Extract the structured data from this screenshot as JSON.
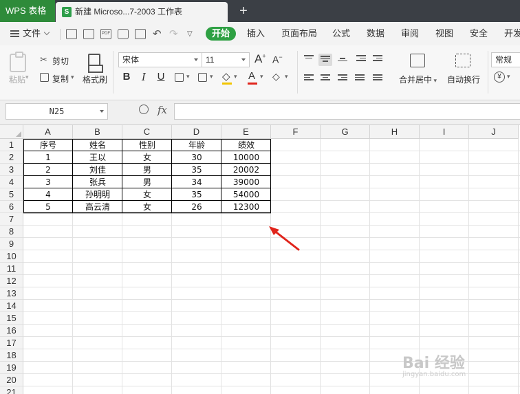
{
  "titlebar": {
    "app_label": "WPS 表格",
    "doc_tab_label": "新建 Microso...7-2003 工作表",
    "new_tab_symbol": "+"
  },
  "menubar": {
    "file_label": "文件",
    "pdf_label": "PDF",
    "undo_symbol": "↶",
    "redo_symbol": "↷",
    "more_symbol": "▽",
    "items": [
      {
        "label": "开始",
        "active": true
      },
      {
        "label": "插入"
      },
      {
        "label": "页面布局"
      },
      {
        "label": "公式"
      },
      {
        "label": "数据"
      },
      {
        "label": "审阅"
      },
      {
        "label": "视图"
      },
      {
        "label": "安全"
      },
      {
        "label": "开发"
      }
    ]
  },
  "ribbon": {
    "paste_label": "粘贴",
    "cut_label": "剪切",
    "copy_label": "复制",
    "format_painter_label": "格式刷",
    "font_name": "宋体",
    "font_size": "11",
    "grow_font": "A",
    "shrink_font": "A",
    "bold": "B",
    "italic": "I",
    "underline": "U",
    "font_color_glyph": "A",
    "merge_label": "合并居中",
    "wrap_label": "自动换行",
    "number_format": "常规",
    "currency_symbol": "¥",
    "accent_color": "#2ea043",
    "font_color": "#e0241b"
  },
  "formulabar": {
    "name_box": "N25",
    "fx_label": "fx",
    "formula_value": ""
  },
  "sheet": {
    "columns": [
      "A",
      "B",
      "C",
      "D",
      "E",
      "F",
      "G",
      "H",
      "I",
      "J"
    ],
    "row_numbers": [
      "1",
      "2",
      "3",
      "4",
      "5",
      "6",
      "7",
      "8",
      "9",
      "10",
      "11",
      "12",
      "13",
      "14",
      "15",
      "16",
      "17",
      "18",
      "19",
      "20",
      "21"
    ],
    "rows": [
      [
        "序号",
        "姓名",
        "性别",
        "年龄",
        "绩效"
      ],
      [
        "1",
        "王以",
        "女",
        "30",
        "10000"
      ],
      [
        "2",
        "刘佳",
        "男",
        "35",
        "20002"
      ],
      [
        "3",
        "张兵",
        "男",
        "34",
        "39000"
      ],
      [
        "4",
        "孙明明",
        "女",
        "35",
        "54000"
      ],
      [
        "5",
        "高云清",
        "女",
        "26",
        "12300"
      ]
    ]
  },
  "annotation": {
    "arrow_color": "#e0241b"
  },
  "watermark": {
    "text": "Bai 经验",
    "sub": "jingyan.baidu.com"
  }
}
